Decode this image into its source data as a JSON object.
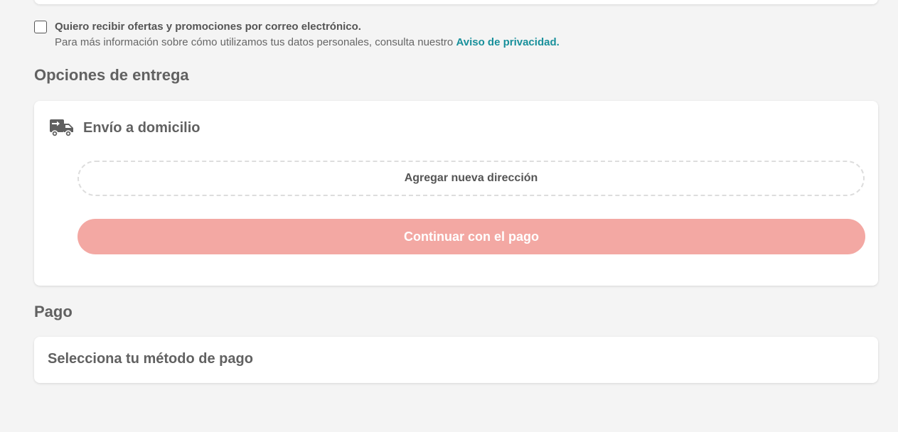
{
  "newsletter": {
    "checked": false,
    "label": "Quiero recibir ofertas y promociones por correo electrónico.",
    "info_text": "Para más información sobre cómo utilizamos tus datos personales, consulta nuestro",
    "privacy_link": "Aviso de privacidad."
  },
  "delivery": {
    "section_title": "Opciones de entrega",
    "option_icon": "truck-icon",
    "option_label": "Envío a domicilio",
    "add_address_label": "Agregar nueva dirección",
    "continue_label": "Continuar con el pago"
  },
  "payment": {
    "section_title": "Pago",
    "select_label": "Selecciona tu método de pago"
  },
  "colors": {
    "background": "#f4f4f4",
    "link": "#18909b",
    "continue_button": "#f3a8a3",
    "text": "#616161"
  }
}
